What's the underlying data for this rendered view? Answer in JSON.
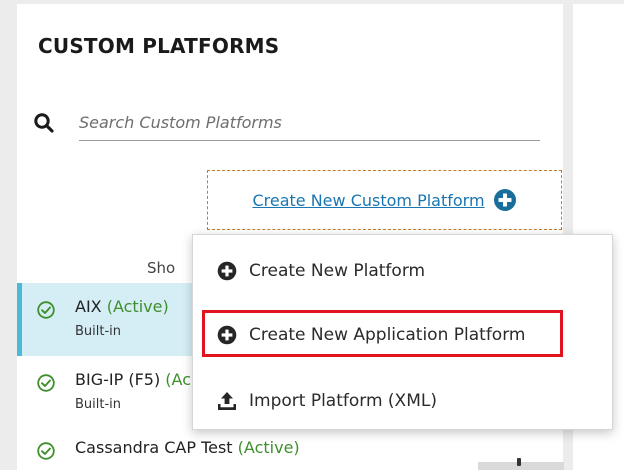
{
  "panel": {
    "title": "CUSTOM PLATFORMS",
    "search": {
      "placeholder": "Search Custom Platforms",
      "icon": "search-icon"
    },
    "create_link": {
      "label": "Create New Custom Platform",
      "icon": "plus-circle-icon"
    },
    "show_text": "Sho",
    "platforms": [
      {
        "name": "AIX",
        "status": "(Active)",
        "type": "Built-in",
        "selected": true
      },
      {
        "name": "BIG-IP (F5)",
        "status": "(Ac",
        "type": "Built-in",
        "selected": false
      },
      {
        "name": "Cassandra CAP Test",
        "status": "(Active)",
        "type": "",
        "selected": false
      }
    ]
  },
  "menu": {
    "items": [
      {
        "label": "Create New Platform",
        "icon": "plus-circle-icon"
      },
      {
        "label": "Create New Application Platform",
        "icon": "plus-circle-icon",
        "highlighted": true
      },
      {
        "label": "Import Platform (XML)",
        "icon": "upload-icon"
      }
    ]
  },
  "colors": {
    "link": "#1976b0",
    "active_status": "#3f8f2c",
    "selected_bg": "#d5eef5",
    "selected_border": "#4bbad9",
    "dashed_border": "#c7792c",
    "highlight": "#e0141e",
    "plus_icon": "#1a6f9a"
  }
}
